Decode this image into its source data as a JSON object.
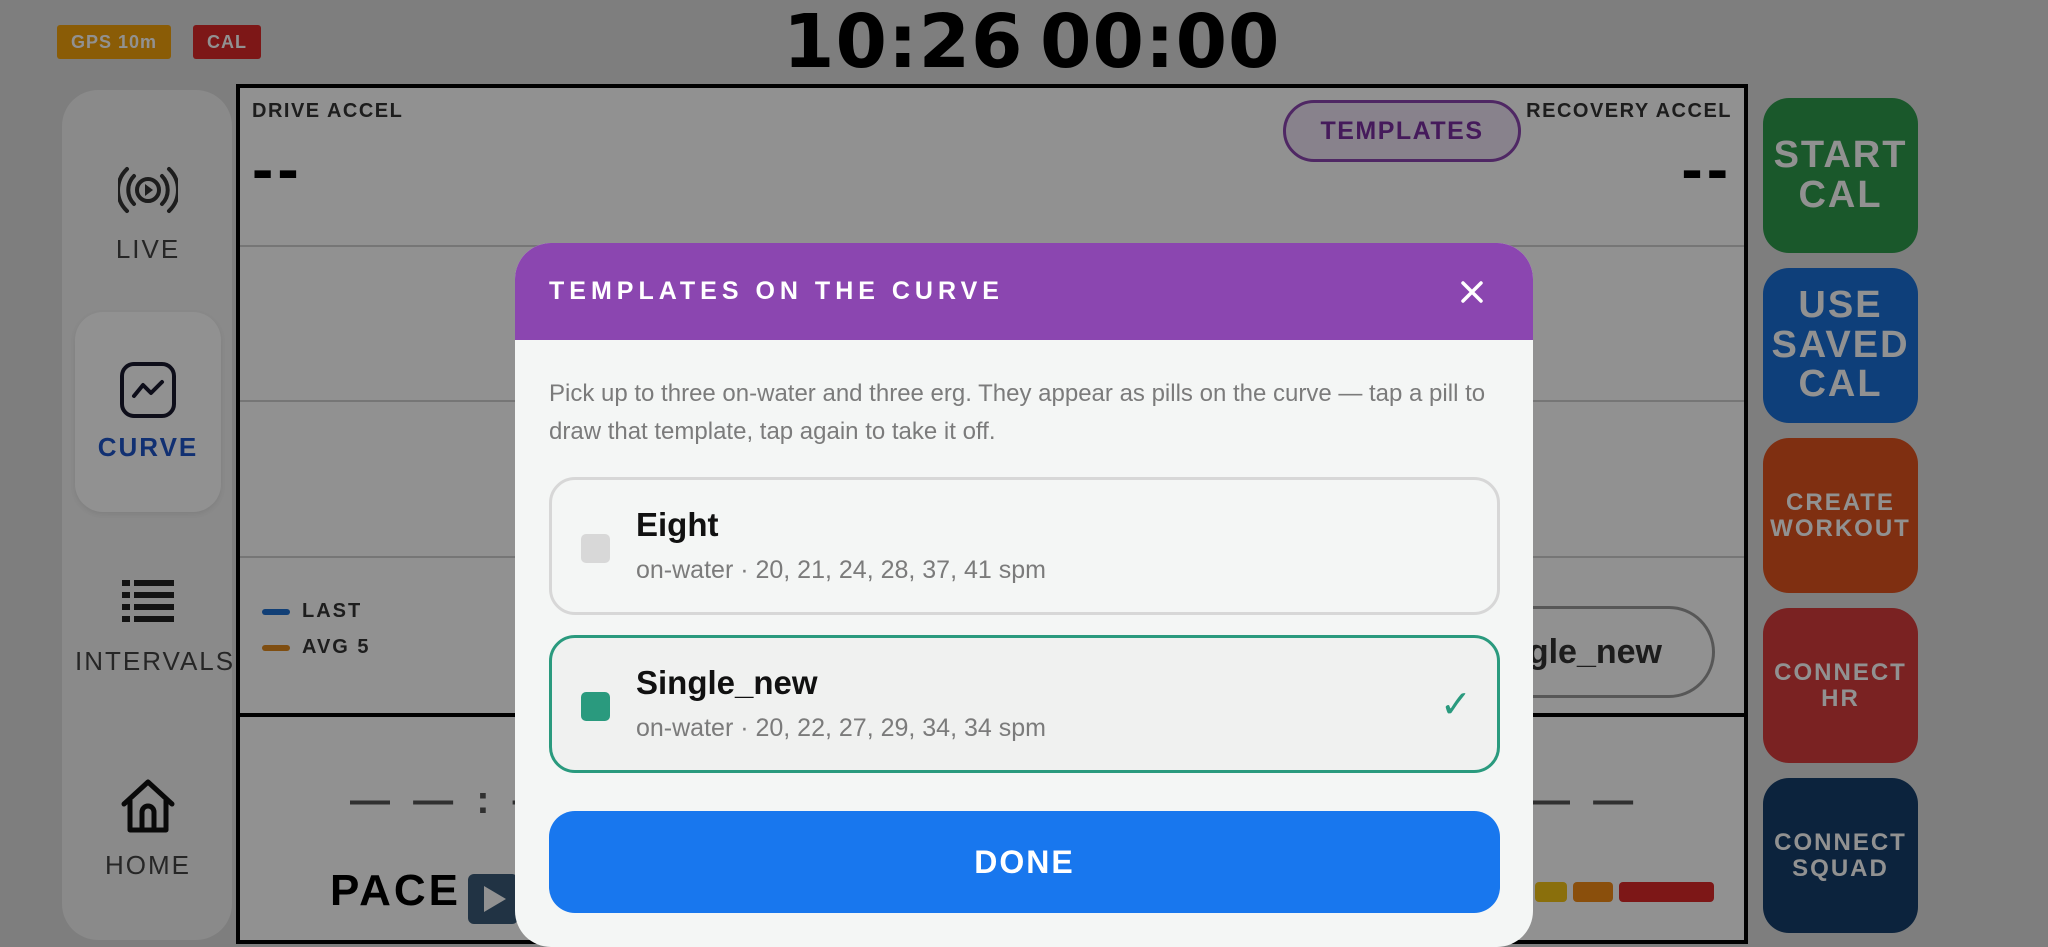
{
  "status": {
    "gps_badge": "GPS 10m",
    "cal_badge": "CAL",
    "time": "10:26",
    "elapsed": "00:00"
  },
  "nav": {
    "live": "LIVE",
    "curve": "CURVE",
    "intervals": "INTERVALS",
    "home": "HOME",
    "active": "curve"
  },
  "curve_panel": {
    "drive_label": "DRIVE ACCEL",
    "drive_value": "--",
    "recovery_label": "RECOVERY ACCEL",
    "recovery_value": "--",
    "templates_button": "TEMPLATES",
    "legend_last": "LAST",
    "legend_avg": "AVG 5",
    "template_pill": "gle_new",
    "pace_label": "PACE"
  },
  "actions": {
    "start_cal": "START\nCAL",
    "use_saved_cal": "USE\nSAVED\nCAL",
    "create_workout": "CREATE\nWORKOUT",
    "connect_hr": "CONNECT\nHR",
    "connect_squad": "CONNECT\nSQUAD"
  },
  "modal": {
    "title": "TEMPLATES ON THE CURVE",
    "description": "Pick up to three on-water and three erg. They appear as pills on the curve — tap a pill to draw that template, tap again to take it off.",
    "options": [
      {
        "name": "Eight",
        "meta": "on-water · 20, 21, 24, 28, 37, 41 spm",
        "selected": false
      },
      {
        "name": "Single_new",
        "meta": "on-water · 20, 22, 27, 29, 34, 34 spm",
        "selected": true,
        "mark": "✓"
      }
    ],
    "done": "DONE"
  },
  "colors": {
    "accent_purple": "#8b46b0",
    "selected_teal": "#2a9a7e",
    "done_blue": "#1877ee",
    "start_cal_green": "#2e9c4d",
    "saved_cal_blue": "#1a6fd6",
    "create_workout_orange": "#e0531f",
    "connect_hr_red": "#d63c3c",
    "connect_squad_navy": "#163f6b"
  }
}
